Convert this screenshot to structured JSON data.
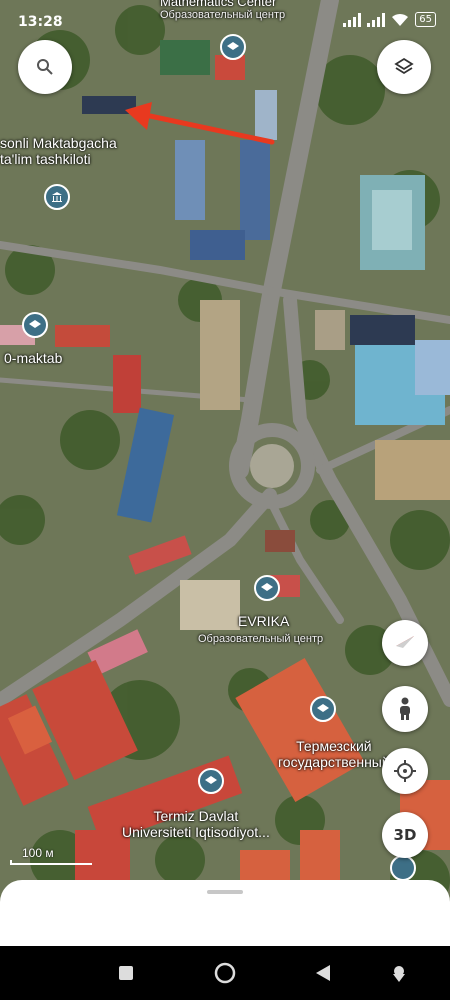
{
  "status_bar": {
    "time": "13:28",
    "battery": "65"
  },
  "map": {
    "top_label": {
      "name": "Mathematics Center",
      "sub": "Образовательный центр"
    },
    "labels": [
      {
        "name": "sonli Maktabgacha"
      },
      {
        "name": "ta'lim tashkiloti"
      },
      {
        "name": "0-maktab"
      },
      {
        "name": "EVRIKA"
      },
      {
        "name": "Образовательный центр"
      },
      {
        "name": "Термезский"
      },
      {
        "name": "государственный"
      },
      {
        "name": "Termiz Davlat"
      },
      {
        "name": "Universiteti Iqtisodiyot..."
      }
    ],
    "scale_label": "100 м"
  },
  "controls": {
    "three_d": "3D"
  },
  "colors": {
    "arrow": "#e8391f",
    "pin": "#3d6f86"
  }
}
